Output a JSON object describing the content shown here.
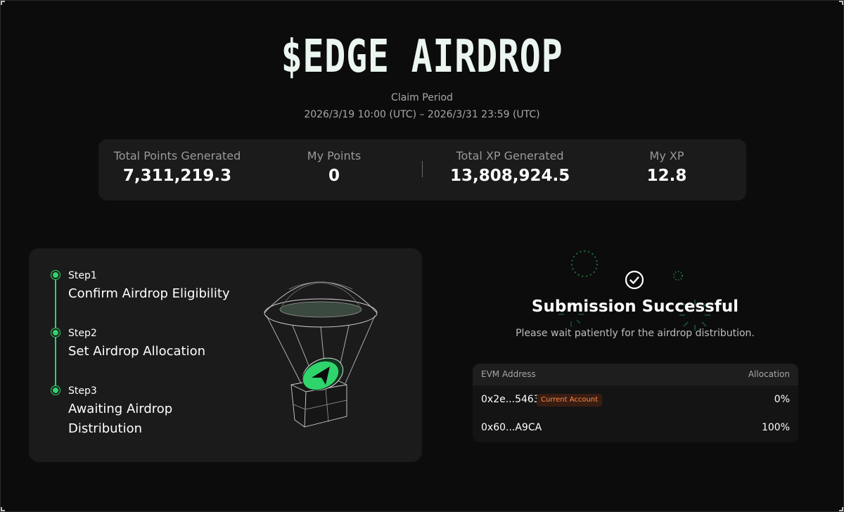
{
  "header": {
    "title": "$EDGE AIRDROP",
    "claim_label": "Claim Period",
    "claim_range": "2026/3/19 10:00 (UTC) – 2026/3/31 23:59 (UTC)"
  },
  "stats": [
    {
      "label": "Total Points Generated",
      "value": "7,311,219.3"
    },
    {
      "label": "My Points",
      "value": "0"
    },
    {
      "label": "Total XP Generated",
      "value": "13,808,924.5"
    },
    {
      "label": "My XP",
      "value": "12.8"
    }
  ],
  "steps": [
    {
      "num": "Step1",
      "text": "Confirm Airdrop Eligibility"
    },
    {
      "num": "Step2",
      "text": "Set Airdrop Allocation"
    },
    {
      "num": "Step3",
      "text": "Awaiting Airdrop Distribution"
    }
  ],
  "success": {
    "icon": "check-circle-icon",
    "title": "Submission Successful",
    "subtitle": "Please wait patiently for the airdrop distribution."
  },
  "table": {
    "col_address": "EVM Address",
    "col_allocation": "Allocation",
    "rows": [
      {
        "address": "0x2e...5463",
        "badge": "Current Account",
        "allocation": "0%"
      },
      {
        "address": "0x60...A9CA",
        "badge": "",
        "allocation": "100%"
      }
    ]
  },
  "colors": {
    "accent": "#2fd46c",
    "background": "#0c0c0c",
    "card": "#1b1b1b",
    "badge_text": "#ff8a4a",
    "badge_bg": "#3a1d12"
  }
}
